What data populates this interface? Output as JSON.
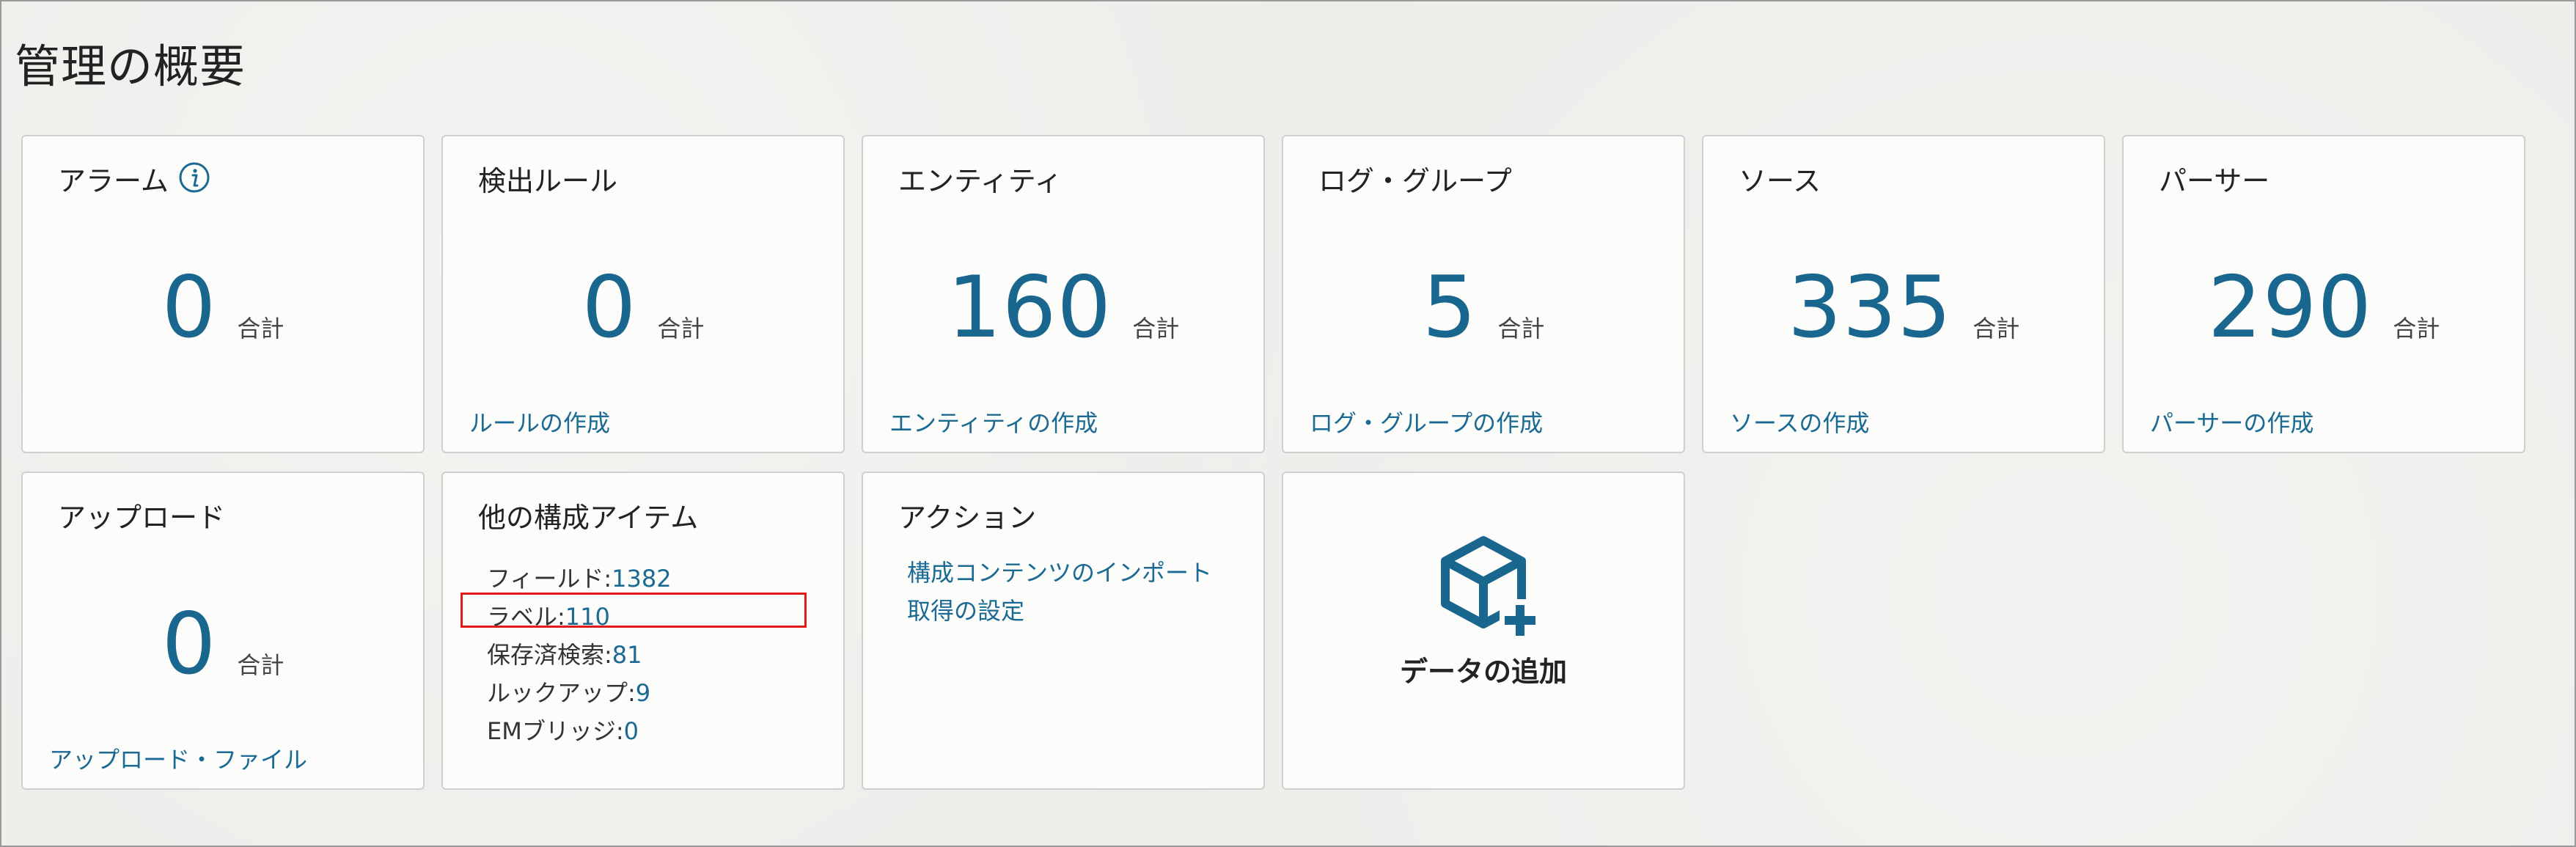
{
  "page": {
    "title": "管理の概要"
  },
  "tiles": {
    "alarms": {
      "title": "アラーム",
      "value": "0",
      "unit": "合計",
      "icon": "info-icon"
    },
    "rules": {
      "title": "検出ルール",
      "value": "0",
      "unit": "合計",
      "link": "ルールの作成"
    },
    "entities": {
      "title": "エンティティ",
      "value": "160",
      "unit": "合計",
      "link": "エンティティの作成"
    },
    "loggroups": {
      "title": "ログ・グループ",
      "value": "5",
      "unit": "合計",
      "link": "ログ・グループの作成"
    },
    "sources": {
      "title": "ソース",
      "value": "335",
      "unit": "合計",
      "link": "ソースの作成"
    },
    "parsers": {
      "title": "パーサー",
      "value": "290",
      "unit": "合計",
      "link": "パーサーの作成"
    },
    "uploads": {
      "title": "アップロード",
      "value": "0",
      "unit": "合計",
      "link": "アップロード・ファイル"
    },
    "other": {
      "title": "他の構成アイテム",
      "items": [
        {
          "label": "フィールド:",
          "value": "1382"
        },
        {
          "label": "ラベル:",
          "value": "110"
        },
        {
          "label": "保存済検索:",
          "value": "81"
        },
        {
          "label": "ルックアップ:",
          "value": "9"
        },
        {
          "label": "EMブリッジ:",
          "value": "0"
        }
      ]
    },
    "actions": {
      "title": "アクション",
      "links": [
        "構成コンテンツのインポート",
        "取得の設定"
      ]
    },
    "add_data": {
      "label": "データの追加",
      "icon": "cube-plus-icon"
    }
  },
  "colors": {
    "accent": "#19668f",
    "link": "#1b6a93",
    "highlight": "#e01b1b"
  }
}
